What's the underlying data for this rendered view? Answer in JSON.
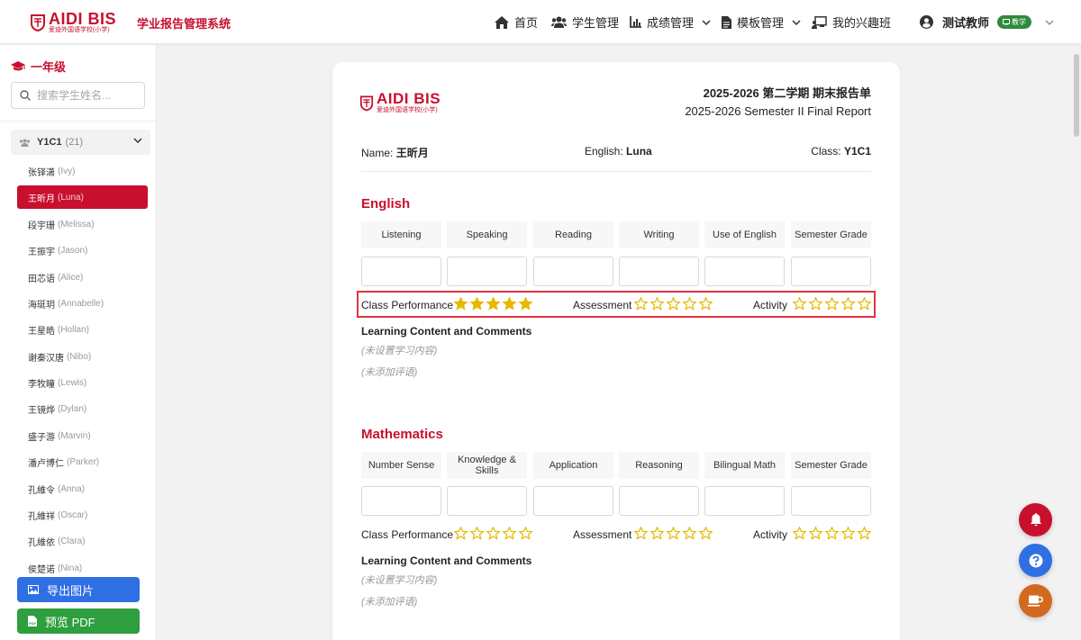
{
  "header": {
    "logo_text": "AIDI BIS",
    "logo_subtext": "爱迪外国语学校(小学)",
    "system_title": "学业报告管理系统",
    "nav": [
      {
        "label": "首页",
        "icon": "home-icon"
      },
      {
        "label": "学生管理",
        "icon": "users-icon"
      },
      {
        "label": "成绩管理",
        "icon": "chart-icon"
      },
      {
        "label": "模板管理",
        "icon": "document-icon"
      },
      {
        "label": "我的兴趣班",
        "icon": "chalkboard-icon"
      }
    ],
    "user_name": "测试教师",
    "user_badge": "教学"
  },
  "sidebar": {
    "grade": "一年级",
    "search_placeholder": "搜索学生姓名...",
    "class_name": "Y1C1",
    "class_count": "(21)",
    "students": [
      {
        "zh": "张铎潇",
        "en": "(Ivy)"
      },
      {
        "zh": "王昕月",
        "en": "(Luna)"
      },
      {
        "zh": "段宇珊",
        "en": "(Melissa)"
      },
      {
        "zh": "王振宇",
        "en": "(Jason)"
      },
      {
        "zh": "田芯语",
        "en": "(Alice)"
      },
      {
        "zh": "海珽玥",
        "en": "(Annabelle)"
      },
      {
        "zh": "王星皓",
        "en": "(Hollan)"
      },
      {
        "zh": "谢秦汉唐",
        "en": "(Nibo)"
      },
      {
        "zh": "李牧瞳",
        "en": "(Lewis)"
      },
      {
        "zh": "王镜烨",
        "en": "(Dylan)"
      },
      {
        "zh": "盛子游",
        "en": "(Marvin)"
      },
      {
        "zh": "潘卢博仁",
        "en": "(Parker)"
      },
      {
        "zh": "孔維令",
        "en": "(Anna)"
      },
      {
        "zh": "孔維祥",
        "en": "(Oscar)"
      },
      {
        "zh": "孔維依",
        "en": "(Clara)"
      },
      {
        "zh": "侯楚诺",
        "en": "(Nina)"
      }
    ],
    "export_image": "导出图片",
    "preview_pdf": "预览 PDF"
  },
  "report": {
    "logo_text": "AIDI BIS",
    "logo_subtext": "爱迪外国语学校(小学)",
    "title_zh": "2025-2026 第二学期 期末报告单",
    "title_en": "2025-2026 Semester II Final Report",
    "name_label": "Name:",
    "name_value": "王昕月",
    "english_label": "English:",
    "english_value": "Luna",
    "class_label": "Class:",
    "class_value": "Y1C1",
    "subjects": [
      {
        "title": "English",
        "columns": [
          "Listening",
          "Speaking",
          "Reading",
          "Writing",
          "Use of English",
          "Semester Grade"
        ],
        "class_performance_label": "Class Performance",
        "class_performance_stars": 5,
        "assessment_label": "Assessment",
        "assessment_stars": 0,
        "activity_label": "Activity",
        "activity_stars": 0,
        "content_title": "Learning Content and Comments",
        "content_note": "(未设置学习内容)",
        "comment_note": "(未添加评语)"
      },
      {
        "title": "Mathematics",
        "columns": [
          "Number Sense",
          "Knowledge & Skills",
          "Application",
          "Reasoning",
          "Bilingual Math",
          "Semester Grade"
        ],
        "class_performance_label": "Class Performance",
        "class_performance_stars": 0,
        "assessment_label": "Assessment",
        "assessment_stars": 0,
        "activity_label": "Activity",
        "activity_stars": 0,
        "content_title": "Learning Content and Comments",
        "content_note": "(未设置学习内容)",
        "comment_note": "(未添加评语)"
      }
    ]
  },
  "colors": {
    "brand_red": "#c8102e",
    "star_gold": "#e6b800",
    "export_blue": "#2f6fe4",
    "pdf_green": "#2e9e3e",
    "fab_red": "#c8102e",
    "fab_blue": "#2f6fe4",
    "fab_orange": "#d2691e"
  },
  "fabs": [
    {
      "icon": "bell-icon"
    },
    {
      "icon": "question-icon"
    },
    {
      "icon": "coffee-icon"
    }
  ]
}
